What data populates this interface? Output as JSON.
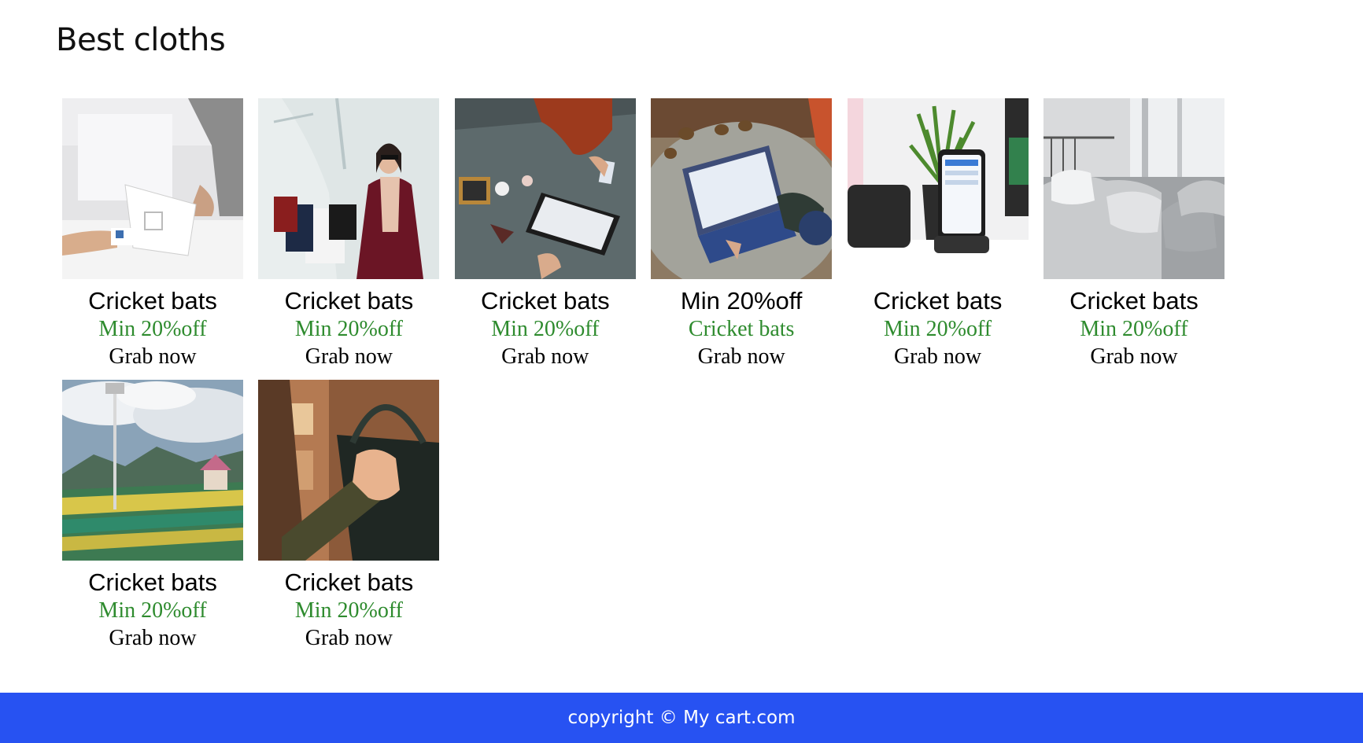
{
  "page": {
    "title": "Best cloths"
  },
  "colors": {
    "footer_bg": "#2752f2",
    "accent_green": "#2e8b2e"
  },
  "products": [
    {
      "title": "Cricket bats",
      "subtitle": "Min 20%off",
      "cta": "Grab now",
      "image": "card-reader-checkout"
    },
    {
      "title": "Cricket bats",
      "subtitle": "Min 20%off",
      "cta": "Grab now",
      "image": "woman-shopping-bags"
    },
    {
      "title": "Cricket bats",
      "subtitle": "Min 20%off",
      "cta": "Grab now",
      "image": "tablet-payment-table"
    },
    {
      "title": "Min 20%off",
      "subtitle": "Cricket bats",
      "cta": "Grab now",
      "image": "laptop-pinecones"
    },
    {
      "title": "Cricket bats",
      "subtitle": "Min 20%off",
      "cta": "Grab now",
      "image": "phone-wireless-charger"
    },
    {
      "title": "Cricket bats",
      "subtitle": "Min 20%off",
      "cta": "Grab now",
      "image": "bedroom-pillows"
    },
    {
      "title": "Cricket bats",
      "subtitle": "Min 20%off",
      "cta": "Grab now",
      "image": "cricket-stadium"
    },
    {
      "title": "Cricket bats",
      "subtitle": "Min 20%off",
      "cta": "Grab now",
      "image": "hand-holding-bag"
    }
  ],
  "footer": {
    "text": "copyright © My cart.com"
  }
}
